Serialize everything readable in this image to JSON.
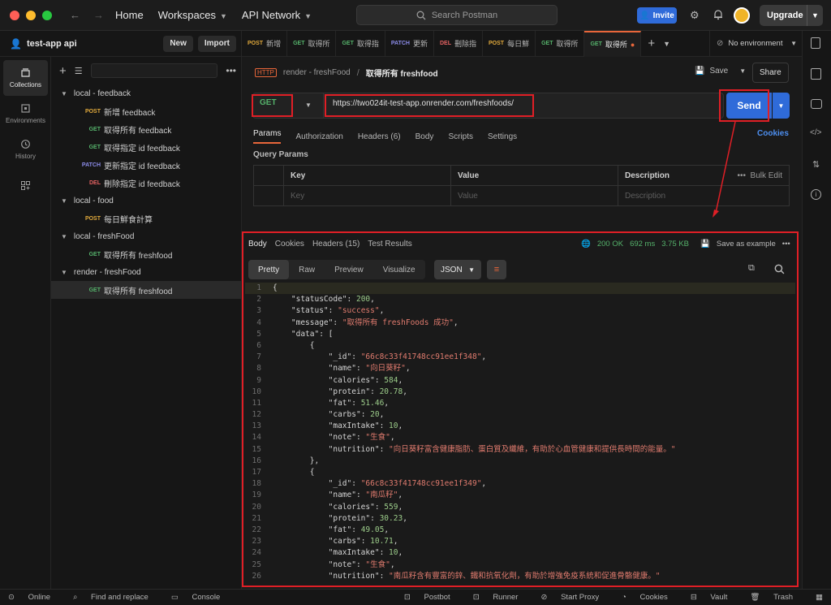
{
  "topbar": {
    "home": "Home",
    "workspaces": "Workspaces",
    "api_network": "API Network",
    "search_placeholder": "Search Postman",
    "invite": "Invite",
    "upgrade": "Upgrade"
  },
  "workspace": {
    "name": "test-app api",
    "new_label": "New",
    "import_label": "Import"
  },
  "rail": [
    {
      "label": "Collections",
      "icon": "collections-icon"
    },
    {
      "label": "Environments",
      "icon": "environments-icon"
    },
    {
      "label": "History",
      "icon": "history-icon"
    }
  ],
  "tree": [
    {
      "type": "folder",
      "label": "local - feedback"
    },
    {
      "type": "req",
      "method": "POST",
      "label": "新增 feedback"
    },
    {
      "type": "req",
      "method": "GET",
      "label": "取得所有 feedback"
    },
    {
      "type": "req",
      "method": "GET",
      "label": "取得指定 id feedback"
    },
    {
      "type": "req",
      "method": "PATCH",
      "label": "更新指定 id feedback"
    },
    {
      "type": "req",
      "method": "DEL",
      "label": "刪除指定 id feedback"
    },
    {
      "type": "folder",
      "label": "local - food"
    },
    {
      "type": "req",
      "method": "POST",
      "label": "每日鮮食計算"
    },
    {
      "type": "folder",
      "label": "local - freshFood"
    },
    {
      "type": "req",
      "method": "GET",
      "label": "取得所有 freshfood"
    },
    {
      "type": "folder",
      "label": "render - freshFood"
    },
    {
      "type": "req",
      "method": "GET",
      "label": "取得所有 freshfood",
      "selected": true
    }
  ],
  "tabs": [
    {
      "method": "POST",
      "label": "新增"
    },
    {
      "method": "GET",
      "label": "取得所"
    },
    {
      "method": "GET",
      "label": "取得指"
    },
    {
      "method": "PATCH",
      "label": "更新"
    },
    {
      "method": "DEL",
      "label": "刪除指"
    },
    {
      "method": "POST",
      "label": "每日鮮"
    },
    {
      "method": "GET",
      "label": "取得所"
    },
    {
      "method": "GET",
      "label": "取得所",
      "active": true
    }
  ],
  "environment": "No environment",
  "request": {
    "breadcrumb_parent": "render - freshFood",
    "breadcrumb_sep": "/",
    "title": "取得所有 freshfood",
    "save_label": "Save",
    "share_label": "Share",
    "method": "GET",
    "url": "https://two024it-test-app.onrender.com/freshfoods/",
    "send_label": "Send",
    "tabs": [
      "Params",
      "Authorization",
      "Headers (6)",
      "Body",
      "Scripts",
      "Settings"
    ],
    "cookies_label": "Cookies",
    "query_params_title": "Query Params",
    "columns": [
      "Key",
      "Value",
      "Description"
    ],
    "bulk_edit": "Bulk Edit",
    "placeholders": [
      "Key",
      "Value",
      "Description"
    ]
  },
  "response": {
    "tabs": [
      "Body",
      "Cookies",
      "Headers (15)",
      "Test Results"
    ],
    "status": "200 OK",
    "time": "692 ms",
    "size": "3.75 KB",
    "save_example": "Save as example",
    "view_modes": [
      "Pretty",
      "Raw",
      "Preview",
      "Visualize"
    ],
    "format": "JSON"
  },
  "code_lines": [
    [
      [
        "pun",
        "{"
      ]
    ],
    [
      [
        "pun",
        "    "
      ],
      [
        "key",
        "\"statusCode\""
      ],
      [
        "pun",
        ": "
      ],
      [
        "num",
        "200"
      ],
      [
        "pun",
        ","
      ]
    ],
    [
      [
        "pun",
        "    "
      ],
      [
        "key",
        "\"status\""
      ],
      [
        "pun",
        ": "
      ],
      [
        "str",
        "\"success\""
      ],
      [
        "pun",
        ","
      ]
    ],
    [
      [
        "pun",
        "    "
      ],
      [
        "key",
        "\"message\""
      ],
      [
        "pun",
        ": "
      ],
      [
        "str",
        "\"取得所有 freshFoods 成功\""
      ],
      [
        "pun",
        ","
      ]
    ],
    [
      [
        "pun",
        "    "
      ],
      [
        "key",
        "\"data\""
      ],
      [
        "pun",
        ": ["
      ]
    ],
    [
      [
        "pun",
        "        {"
      ]
    ],
    [
      [
        "pun",
        "            "
      ],
      [
        "key",
        "\"_id\""
      ],
      [
        "pun",
        ": "
      ],
      [
        "str",
        "\"66c8c33f41748cc91ee1f348\""
      ],
      [
        "pun",
        ","
      ]
    ],
    [
      [
        "pun",
        "            "
      ],
      [
        "key",
        "\"name\""
      ],
      [
        "pun",
        ": "
      ],
      [
        "str",
        "\"向日葵籽\""
      ],
      [
        "pun",
        ","
      ]
    ],
    [
      [
        "pun",
        "            "
      ],
      [
        "key",
        "\"calories\""
      ],
      [
        "pun",
        ": "
      ],
      [
        "num",
        "584"
      ],
      [
        "pun",
        ","
      ]
    ],
    [
      [
        "pun",
        "            "
      ],
      [
        "key",
        "\"protein\""
      ],
      [
        "pun",
        ": "
      ],
      [
        "num",
        "20.78"
      ],
      [
        "pun",
        ","
      ]
    ],
    [
      [
        "pun",
        "            "
      ],
      [
        "key",
        "\"fat\""
      ],
      [
        "pun",
        ": "
      ],
      [
        "num",
        "51.46"
      ],
      [
        "pun",
        ","
      ]
    ],
    [
      [
        "pun",
        "            "
      ],
      [
        "key",
        "\"carbs\""
      ],
      [
        "pun",
        ": "
      ],
      [
        "num",
        "20"
      ],
      [
        "pun",
        ","
      ]
    ],
    [
      [
        "pun",
        "            "
      ],
      [
        "key",
        "\"maxIntake\""
      ],
      [
        "pun",
        ": "
      ],
      [
        "num",
        "10"
      ],
      [
        "pun",
        ","
      ]
    ],
    [
      [
        "pun",
        "            "
      ],
      [
        "key",
        "\"note\""
      ],
      [
        "pun",
        ": "
      ],
      [
        "str",
        "\"生食\""
      ],
      [
        "pun",
        ","
      ]
    ],
    [
      [
        "pun",
        "            "
      ],
      [
        "key",
        "\"nutrition\""
      ],
      [
        "pun",
        ": "
      ],
      [
        "str",
        "\"向日葵籽富含健康脂肪、蛋白質及纖維，有助於心血管健康和提供長時間的能量。\""
      ]
    ],
    [
      [
        "pun",
        "        },"
      ]
    ],
    [
      [
        "pun",
        "        {"
      ]
    ],
    [
      [
        "pun",
        "            "
      ],
      [
        "key",
        "\"_id\""
      ],
      [
        "pun",
        ": "
      ],
      [
        "str",
        "\"66c8c33f41748cc91ee1f349\""
      ],
      [
        "pun",
        ","
      ]
    ],
    [
      [
        "pun",
        "            "
      ],
      [
        "key",
        "\"name\""
      ],
      [
        "pun",
        ": "
      ],
      [
        "str",
        "\"南瓜籽\""
      ],
      [
        "pun",
        ","
      ]
    ],
    [
      [
        "pun",
        "            "
      ],
      [
        "key",
        "\"calories\""
      ],
      [
        "pun",
        ": "
      ],
      [
        "num",
        "559"
      ],
      [
        "pun",
        ","
      ]
    ],
    [
      [
        "pun",
        "            "
      ],
      [
        "key",
        "\"protein\""
      ],
      [
        "pun",
        ": "
      ],
      [
        "num",
        "30.23"
      ],
      [
        "pun",
        ","
      ]
    ],
    [
      [
        "pun",
        "            "
      ],
      [
        "key",
        "\"fat\""
      ],
      [
        "pun",
        ": "
      ],
      [
        "num",
        "49.05"
      ],
      [
        "pun",
        ","
      ]
    ],
    [
      [
        "pun",
        "            "
      ],
      [
        "key",
        "\"carbs\""
      ],
      [
        "pun",
        ": "
      ],
      [
        "num",
        "10.71"
      ],
      [
        "pun",
        ","
      ]
    ],
    [
      [
        "pun",
        "            "
      ],
      [
        "key",
        "\"maxIntake\""
      ],
      [
        "pun",
        ": "
      ],
      [
        "num",
        "10"
      ],
      [
        "pun",
        ","
      ]
    ],
    [
      [
        "pun",
        "            "
      ],
      [
        "key",
        "\"note\""
      ],
      [
        "pun",
        ": "
      ],
      [
        "str",
        "\"生食\""
      ],
      [
        "pun",
        ","
      ]
    ],
    [
      [
        "pun",
        "            "
      ],
      [
        "key",
        "\"nutrition\""
      ],
      [
        "pun",
        ": "
      ],
      [
        "str",
        "\"南瓜籽含有豐富的鋅、鐵和抗氧化劑，有助於增強免疫系統和促進骨骼健康。\""
      ]
    ]
  ],
  "statusbar": {
    "online": "Online",
    "find_replace": "Find and replace",
    "console": "Console",
    "postbot": "Postbot",
    "runner": "Runner",
    "start_proxy": "Start Proxy",
    "cookies": "Cookies",
    "vault": "Vault",
    "trash": "Trash"
  },
  "colors": {
    "accent": "#e8663a",
    "send": "#2f6bd9",
    "annotation": "#e01f26"
  }
}
